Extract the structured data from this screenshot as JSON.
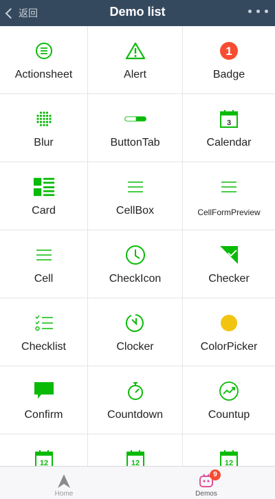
{
  "header": {
    "back_label": "返回",
    "title": "Demo list"
  },
  "colors": {
    "accent": "#09bb07",
    "header_bg": "#35495e",
    "badge_red": "#f74c31",
    "colorpicker_yellow": "#f1c40f"
  },
  "demos": [
    {
      "label": "Actionsheet",
      "icon": "actionsheet-icon"
    },
    {
      "label": "Alert",
      "icon": "alert-icon"
    },
    {
      "label": "Badge",
      "icon": "badge-icon",
      "badge_text": "1"
    },
    {
      "label": "Blur",
      "icon": "blur-icon"
    },
    {
      "label": "ButtonTab",
      "icon": "buttontab-icon"
    },
    {
      "label": "Calendar",
      "icon": "calendar-icon",
      "icon_text": "3"
    },
    {
      "label": "Card",
      "icon": "card-icon"
    },
    {
      "label": "CellBox",
      "icon": "cellbox-icon"
    },
    {
      "label": "CellFormPreview",
      "icon": "cellformpreview-icon"
    },
    {
      "label": "Cell",
      "icon": "cell-icon"
    },
    {
      "label": "CheckIcon",
      "icon": "checkicon-icon"
    },
    {
      "label": "Checker",
      "icon": "checker-icon"
    },
    {
      "label": "Checklist",
      "icon": "checklist-icon"
    },
    {
      "label": "Clocker",
      "icon": "clocker-icon"
    },
    {
      "label": "ColorPicker",
      "icon": "colorpicker-icon"
    },
    {
      "label": "Confirm",
      "icon": "confirm-icon"
    },
    {
      "label": "Countdown",
      "icon": "countdown-icon"
    },
    {
      "label": "Countup",
      "icon": "countup-icon"
    },
    {
      "label": "",
      "icon": "datetime-icon",
      "icon_text": "12"
    },
    {
      "label": "",
      "icon": "datetime-icon",
      "icon_text": "12"
    },
    {
      "label": "",
      "icon": "datetime-icon",
      "icon_text": "12"
    }
  ],
  "tabbar": {
    "home_label": "Home",
    "home_icon": "navigation-arrow-icon",
    "demos_label": "Demos",
    "demos_icon": "demos-icon",
    "demos_badge": "9"
  }
}
